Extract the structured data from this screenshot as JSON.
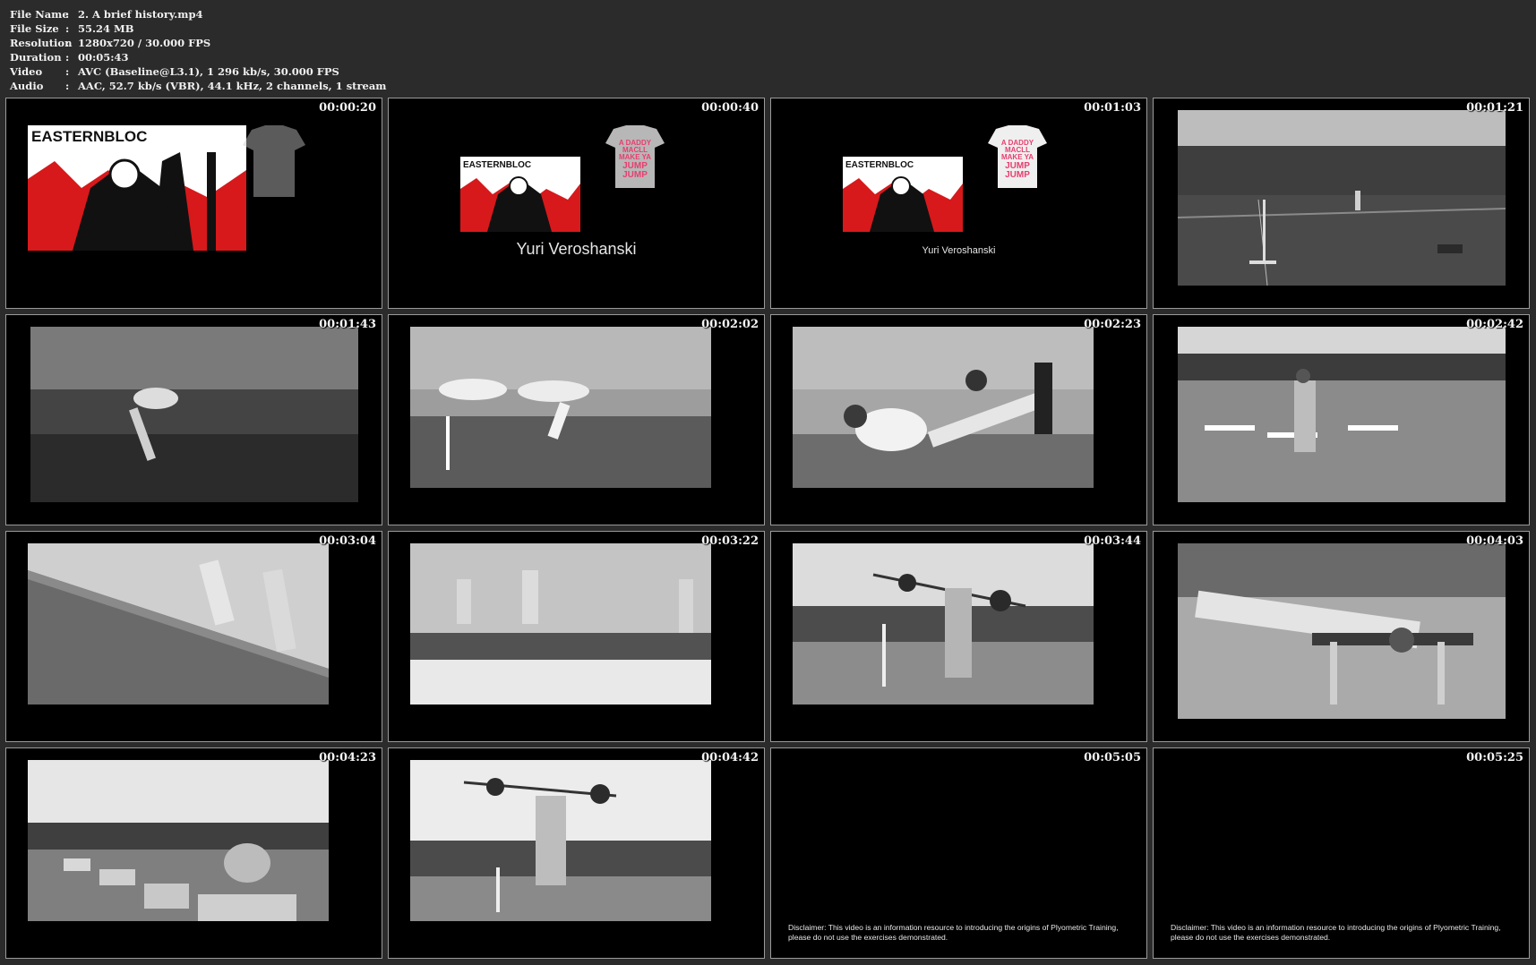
{
  "meta": {
    "rows": [
      {
        "label": "File Name",
        "value": "2. A brief history.mp4"
      },
      {
        "label": "File Size",
        "value": "55.24 MB"
      },
      {
        "label": "Resolution",
        "value": "1280x720 / 30.000 FPS"
      },
      {
        "label": "Duration",
        "value": "00:05:43"
      },
      {
        "label": "Video",
        "value": "AVC (Baseline@L3.1), 1 296 kb/s, 30.000 FPS"
      },
      {
        "label": "Audio",
        "value": "AAC, 52.7 kb/s (VBR), 44.1 kHz, 2 channels, 1 stream"
      }
    ],
    "separator": ":"
  },
  "logo": {
    "brand": "EASTERNBLOC",
    "shirt_lines": [
      "A DADDY",
      "MACLL",
      "MAKE YA",
      "JUMP",
      "JUMP"
    ]
  },
  "credit_name": "Yuri Veroshanski",
  "disclaimer": "Disclaimer: This video is an information resource to introducing the origins of Plyometric Training, please do not use the exercises demonstrated.",
  "thumbnails": [
    {
      "time": "00:00:20",
      "scene": "logo-large"
    },
    {
      "time": "00:00:40",
      "scene": "logo-credit-large"
    },
    {
      "time": "00:01:03",
      "scene": "logo-credit-small"
    },
    {
      "time": "00:01:21",
      "scene": "track-field"
    },
    {
      "time": "00:01:43",
      "scene": "hurdle-banner"
    },
    {
      "time": "00:02:02",
      "scene": "stadium-runner"
    },
    {
      "time": "00:02:23",
      "scene": "leg-press"
    },
    {
      "time": "00:02:42",
      "scene": "hurdles-jump"
    },
    {
      "time": "00:03:04",
      "scene": "slope-run"
    },
    {
      "time": "00:03:22",
      "scene": "sprinters"
    },
    {
      "time": "00:03:44",
      "scene": "barbell-field"
    },
    {
      "time": "00:04:03",
      "scene": "bench-machine"
    },
    {
      "time": "00:04:23",
      "scene": "box-jump"
    },
    {
      "time": "00:04:42",
      "scene": "barbell-squat"
    },
    {
      "time": "00:05:05",
      "scene": "disclaimer"
    },
    {
      "time": "00:05:25",
      "scene": "disclaimer"
    }
  ]
}
